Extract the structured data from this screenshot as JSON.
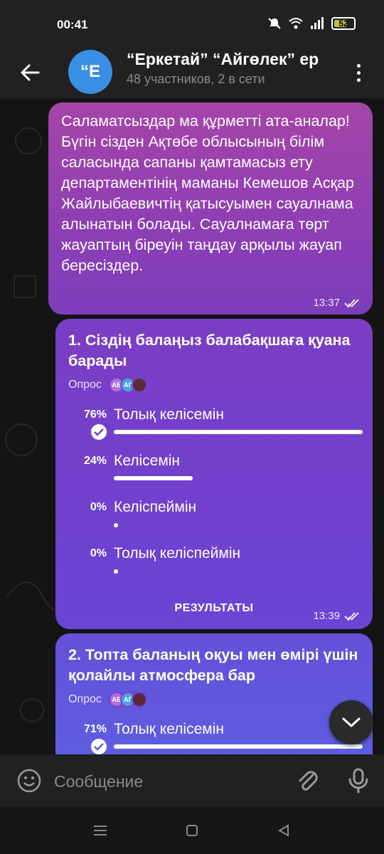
{
  "status_bar": {
    "time": "00:41",
    "battery": "52"
  },
  "header": {
    "avatar_letter": "“Е",
    "title": "“Еркетай” “Айгөлек” ер",
    "subtitle": "48 участников, 2 в сети"
  },
  "message": {
    "text": "Саламатсыздар ма құрметті ата-аналар! Бүгін сізден Ақтөбе облысының білім саласында сапаны қамтамасыз ету департаментінің маманы Кемешов Асқар Жайлыбаевичтің қатысуымен сауалнама алынатын болады. Сауалнамаға төрт жауаптың біреуін таңдау арқылы жауап бересіздер.",
    "time": "13:37"
  },
  "polls": [
    {
      "question": "1. Сіздің балаңыз балабақшаға қуана барады",
      "type": "Опрос",
      "voters": [
        "АБ",
        "АГ",
        ""
      ],
      "options": [
        {
          "percent": "76%",
          "label": "Толық келісемін",
          "value": 0.76,
          "chosen": true
        },
        {
          "percent": "24%",
          "label": "Келісемін",
          "value": 0.24,
          "chosen": false
        },
        {
          "percent": "0%",
          "label": "Келіспеймін",
          "value": 0,
          "chosen": false
        },
        {
          "percent": "0%",
          "label": "Толық келіспеймін",
          "value": 0,
          "chosen": false
        }
      ],
      "results_label": "РЕЗУЛЬТАТЫ",
      "time": "13:39"
    },
    {
      "question": "2. Топта баланың оқуы мен өмірі үшін қолайлы атмосфера бар",
      "type": "Опрос",
      "voters": [
        "АБ",
        "АГ",
        ""
      ],
      "options": [
        {
          "percent": "71%",
          "label": "Толық келісемін",
          "value": 0.71,
          "chosen": true
        }
      ]
    }
  ],
  "input": {
    "placeholder": "Сообщение"
  },
  "icons": [
    "back-arrow-icon",
    "more-vert-icon",
    "double-check-icon",
    "check-icon",
    "chevron-down-icon",
    "emoji-icon",
    "attach-icon",
    "mic-icon",
    "nav-menu-icon",
    "nav-home-icon",
    "nav-back-icon"
  ],
  "colors": {
    "bubble_top": "#a545a8",
    "bubble_bottom": "#6a45d5",
    "accent_avatar": "#3b8ee6",
    "background": "#141414"
  }
}
